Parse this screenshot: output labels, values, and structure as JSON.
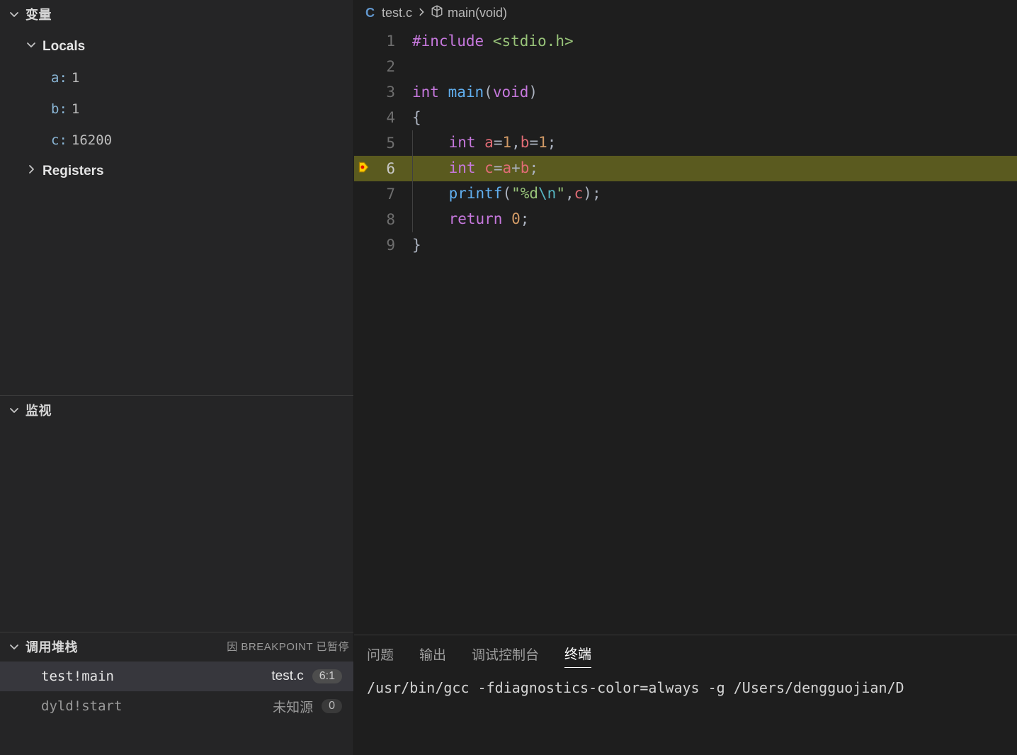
{
  "sidebar": {
    "variables": {
      "title": "变量",
      "scopes": [
        {
          "name": "Locals",
          "expanded": true,
          "vars": [
            {
              "name": "a",
              "value": "1"
            },
            {
              "name": "b",
              "value": "1"
            },
            {
              "name": "c",
              "value": "16200"
            }
          ]
        },
        {
          "name": "Registers",
          "expanded": false
        }
      ]
    },
    "watch": {
      "title": "监视"
    },
    "callstack": {
      "title": "调用堆栈",
      "hint": "因 BREAKPOINT 已暂停",
      "frames": [
        {
          "fn": "test!main",
          "src": "test.c",
          "loc": "6:1",
          "active": true
        },
        {
          "fn": "dyld!start",
          "src": "未知源",
          "loc": "0",
          "active": false
        }
      ]
    }
  },
  "breadcrumbs": {
    "file": "test.c",
    "symbol": "main(void)"
  },
  "code": {
    "current_line": 6,
    "lines": [
      {
        "n": 1,
        "html": "<span class='tk-pp'>#include</span> <span class='tk-inc'>&lt;stdio.h&gt;</span>"
      },
      {
        "n": 2,
        "html": ""
      },
      {
        "n": 3,
        "html": "<span class='tk-type'>int</span> <span class='tk-fn'>main</span><span class='tk-punc'>(</span><span class='tk-param'>void</span><span class='tk-punc'>)</span>"
      },
      {
        "n": 4,
        "html": "<span class='tk-punc'>{</span>"
      },
      {
        "n": 5,
        "indent": true,
        "html": "    <span class='tk-type'>int</span> <span class='tk-var'>a</span><span class='tk-punc'>=</span><span class='tk-num'>1</span><span class='tk-punc'>,</span><span class='tk-var'>b</span><span class='tk-punc'>=</span><span class='tk-num'>1</span><span class='tk-punc'>;</span>"
      },
      {
        "n": 6,
        "indent": true,
        "html": "    <span class='tk-type'>int</span> <span class='tk-var'>c</span><span class='tk-punc'>=</span><span class='tk-var'>a</span><span class='tk-punc'>+</span><span class='tk-var'>b</span><span class='tk-punc'>;</span>"
      },
      {
        "n": 7,
        "indent": true,
        "html": "    <span class='tk-fn'>printf</span><span class='tk-punc'>(</span><span class='tk-str'>\"%d</span><span class='tk-esc'>\\n</span><span class='tk-str'>\"</span><span class='tk-punc'>,</span><span class='tk-var'>c</span><span class='tk-punc'>);</span>"
      },
      {
        "n": 8,
        "indent": true,
        "html": "    <span class='tk-kw'>return</span> <span class='tk-num'>0</span><span class='tk-punc'>;</span>"
      },
      {
        "n": 9,
        "html": "<span class='tk-punc'>}</span>"
      }
    ]
  },
  "terminal": {
    "tabs": [
      "问题",
      "输出",
      "调试控制台",
      "终端"
    ],
    "active_tab": 3,
    "line": "/usr/bin/gcc -fdiagnostics-color=always -g /Users/dengguojian/D"
  }
}
